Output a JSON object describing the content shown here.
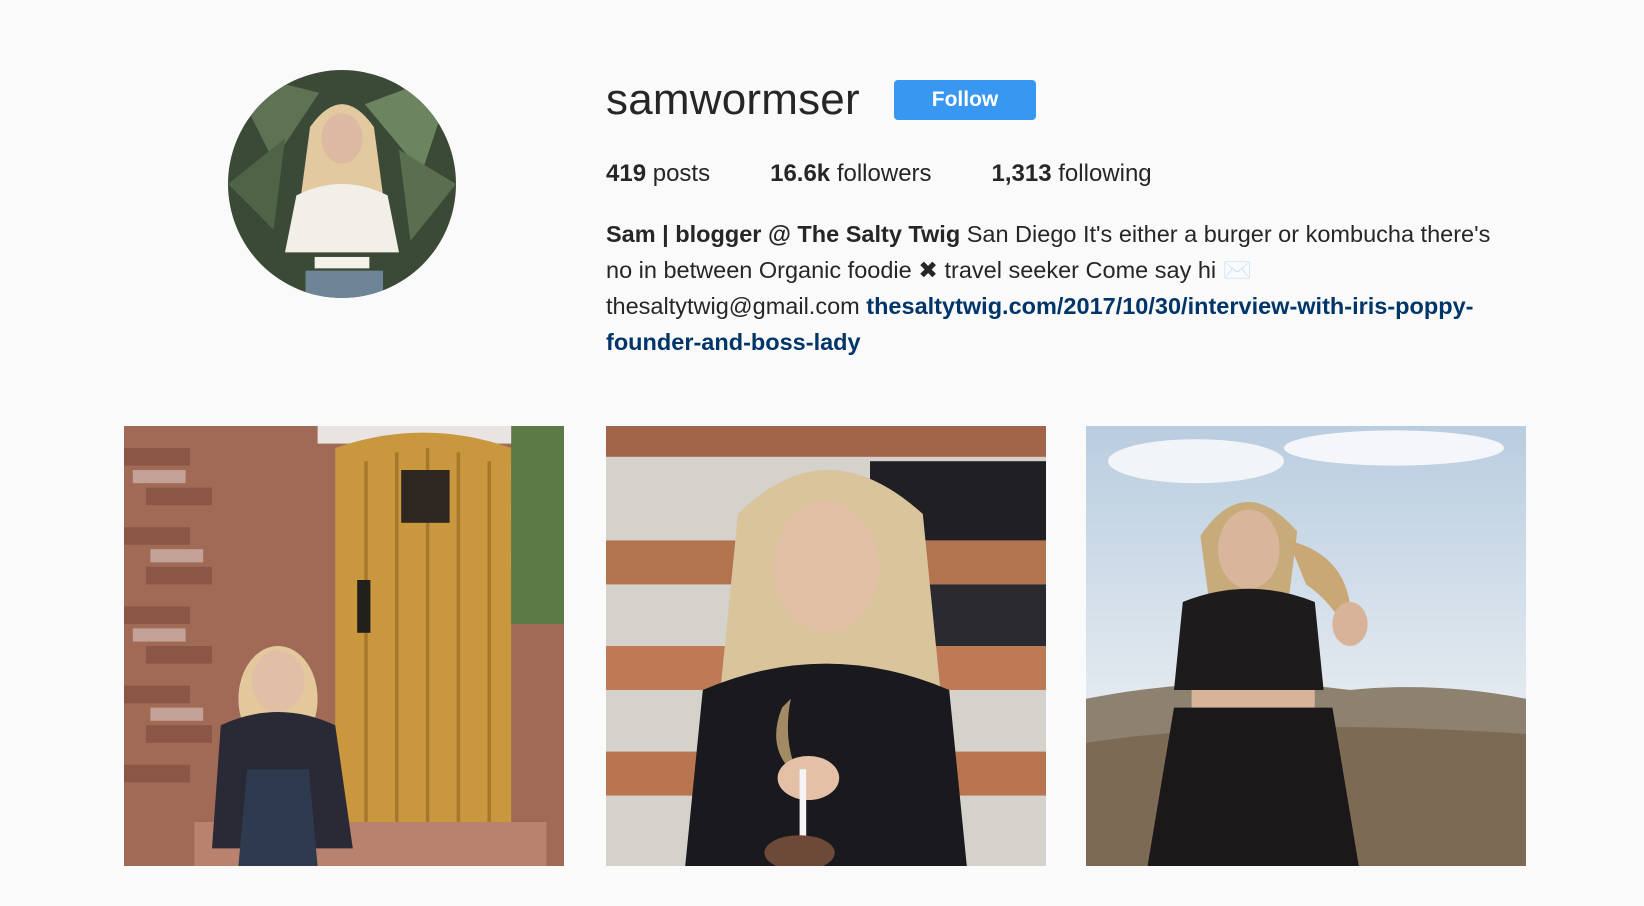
{
  "profile": {
    "username": "samwormser",
    "follow_label": "Follow",
    "avatar_icon": "profile-photo"
  },
  "stats": {
    "posts_count": "419",
    "posts_label": "posts",
    "followers_count": "16.6k",
    "followers_label": "followers",
    "following_count": "1,313",
    "following_label": "following"
  },
  "bio": {
    "full_name": "Sam | blogger @ The Salty Twig",
    "text_1": " San Diego It's either a burger or kombucha there's no in between Organic foodie ",
    "cross_glyph": "✖",
    "text_2": " travel seeker Come say hi ",
    "envelope_glyph": "✉️",
    "text_3": " thesaltytwig@gmail.com ",
    "link": "thesaltytwig.com/2017/10/30/interview-with-iris-poppy-founder-and-boss-lady"
  },
  "posts": [
    {
      "name": "post-brick-door"
    },
    {
      "name": "post-smiling-dessert"
    },
    {
      "name": "post-desert-field"
    }
  ],
  "colors": {
    "background": "#fafafa",
    "follow_button": "#3897f0",
    "link": "#003569",
    "text": "#262626"
  }
}
